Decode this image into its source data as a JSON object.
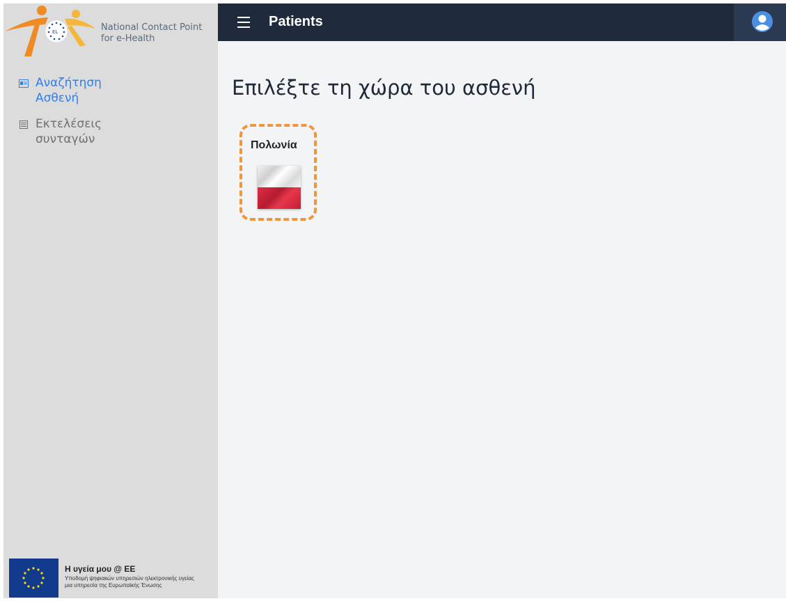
{
  "logo": {
    "line1": "National Contact Point",
    "line2": "for e-Health",
    "badge": "EL"
  },
  "sidebar": {
    "items": [
      {
        "label": "Αναζήτηση Ασθενή",
        "icon": "id-card-icon",
        "active": true
      },
      {
        "label": "Εκτελέσεις συνταγών",
        "icon": "list-icon",
        "active": false
      }
    ]
  },
  "footer": {
    "title": "Η υγεία μου @ ΕΕ",
    "subtitle_line1": "Υποδομή ψηφιακών υπηρεσιών ηλεκτρονικής υγείας",
    "subtitle_line2": "μια υπηρεσία της Ευρωπαϊκής Ένωσης"
  },
  "topbar": {
    "title": "Patients",
    "menu_icon": "hamburger-icon",
    "user_icon": "user-avatar-icon"
  },
  "main": {
    "heading": "Επιλέξτε τη χώρα του ασθενή",
    "countries": [
      {
        "name": "Πολωνία",
        "flag": "poland-flag"
      }
    ]
  },
  "colors": {
    "topbar": "#1f2a3c",
    "sidebar": "#dcdcdc",
    "accent": "#2f80ed",
    "highlight": "#f0953c",
    "main_bg": "#f3f4f6"
  }
}
